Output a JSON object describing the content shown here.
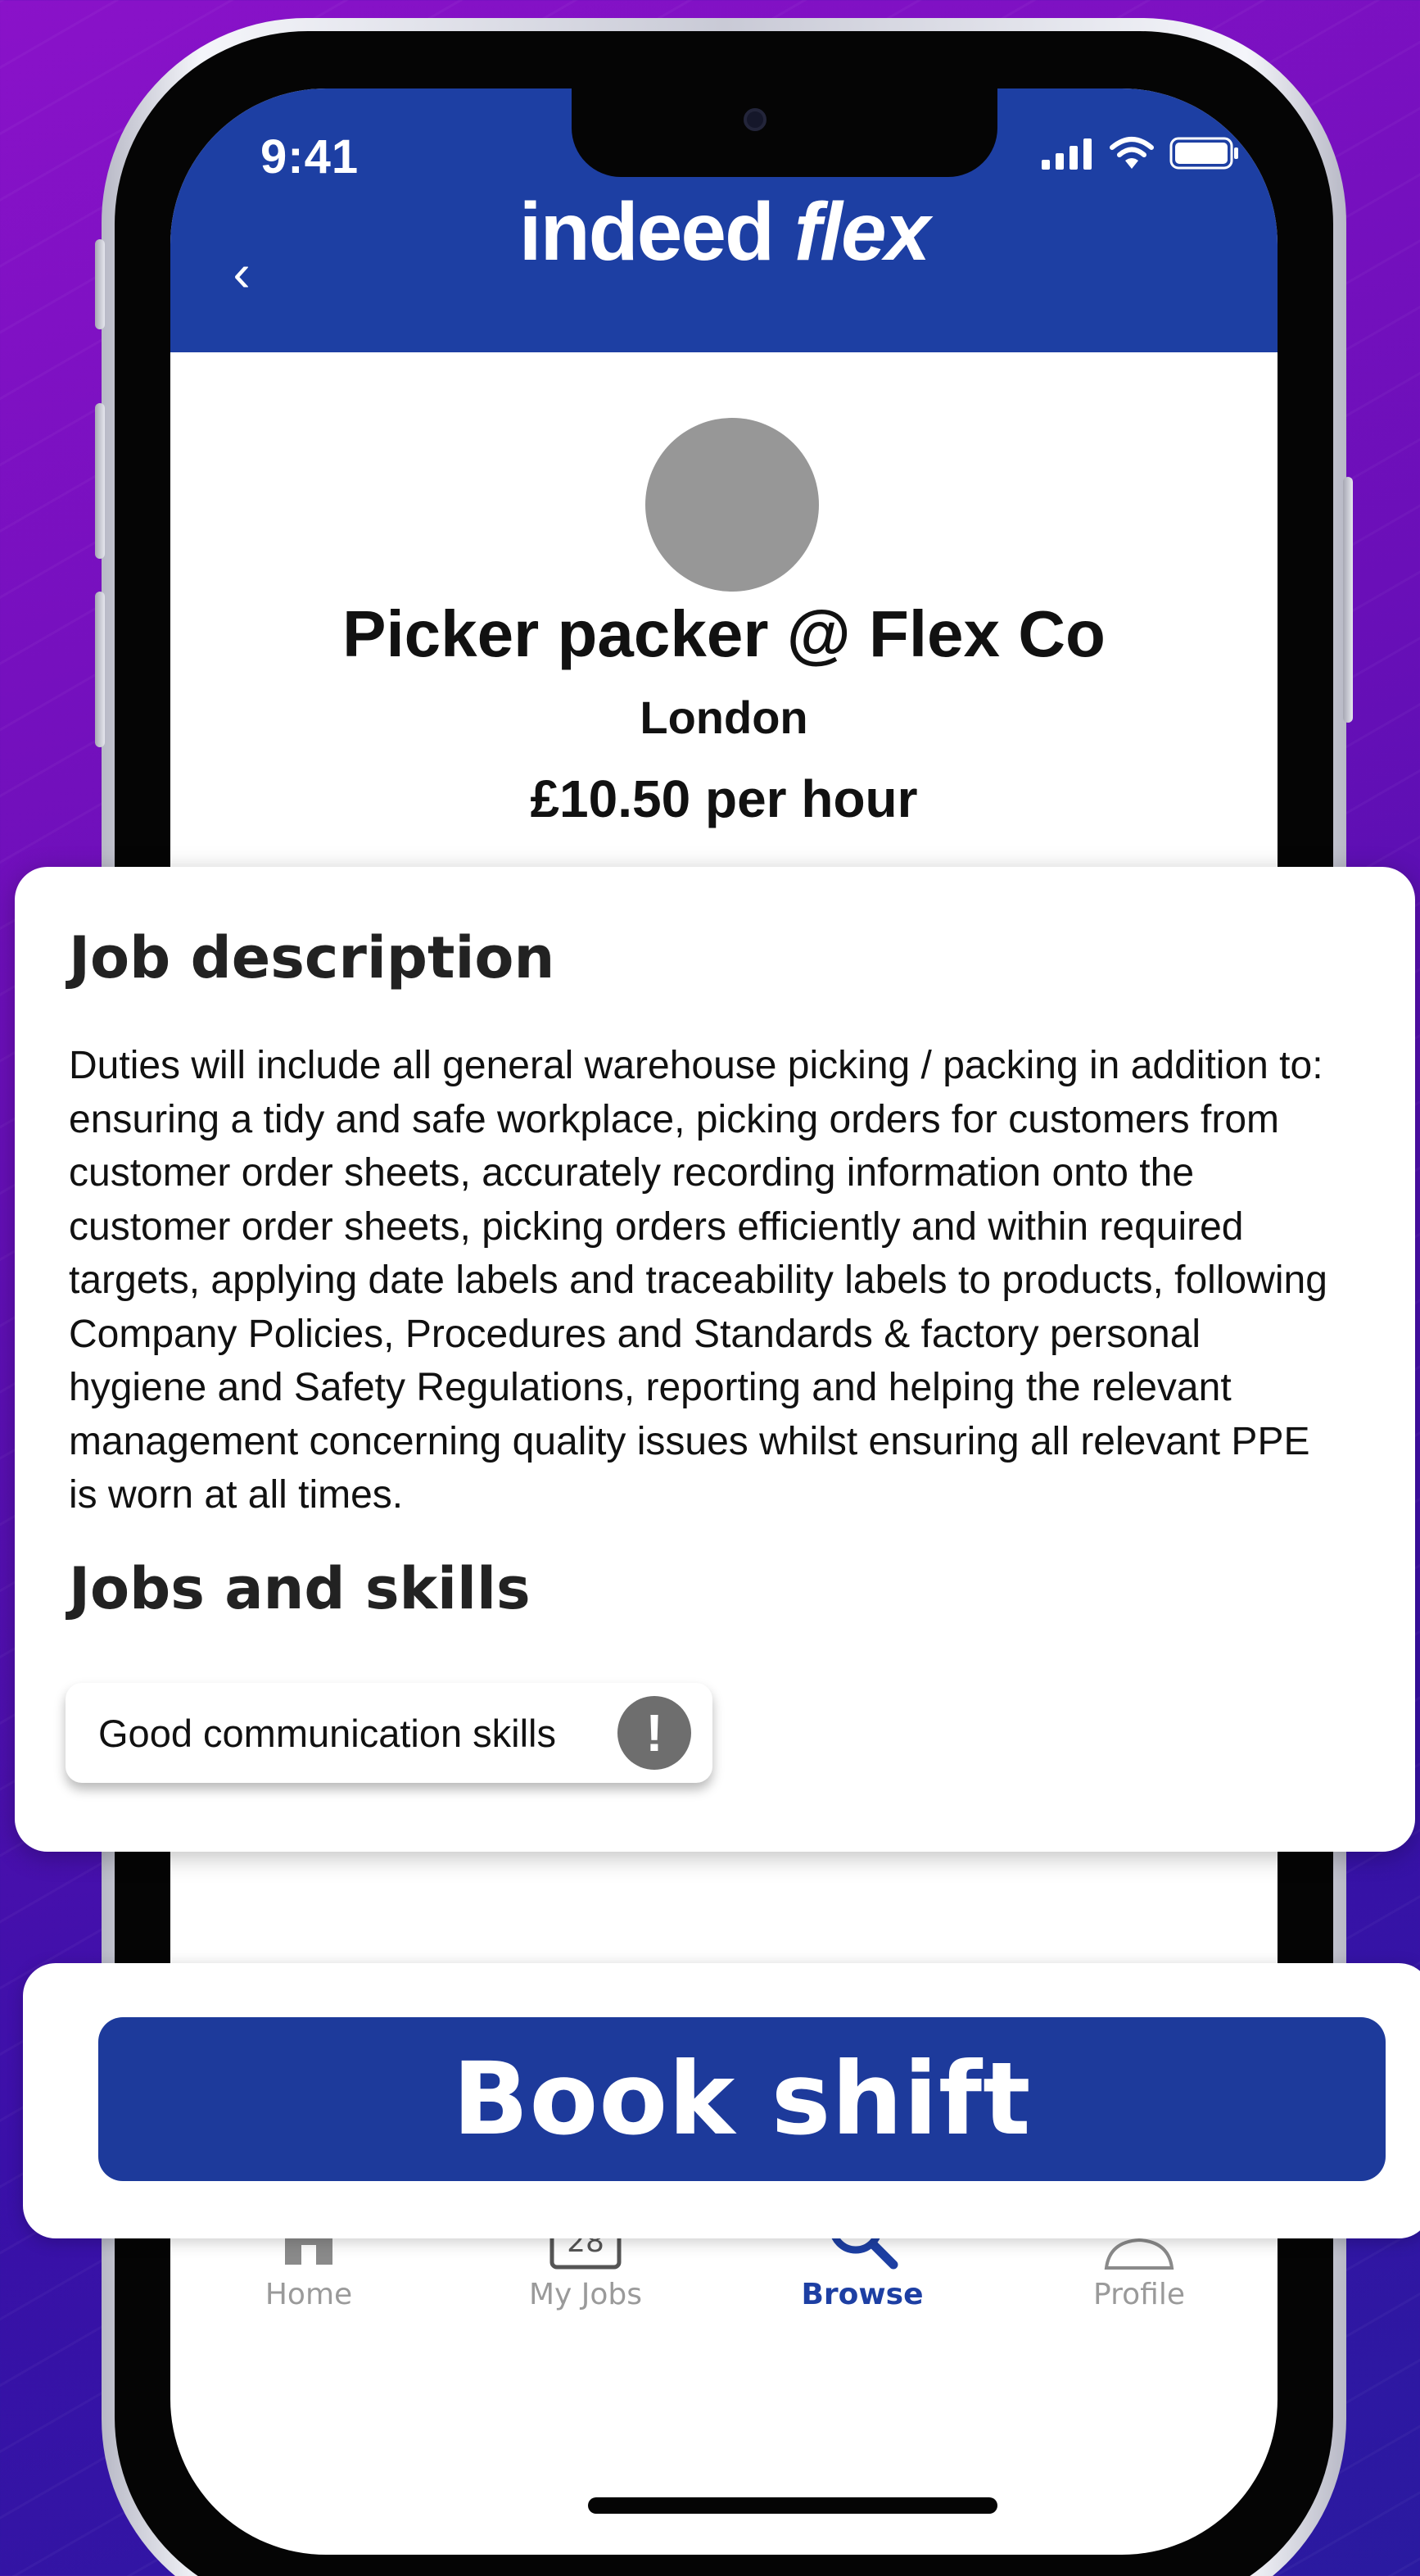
{
  "status_bar": {
    "time": "9:41"
  },
  "header": {
    "brand_main": "indeed",
    "brand_accent": "flex",
    "back_symbol": "‹"
  },
  "job": {
    "title": "Picker packer @ Flex Co",
    "location": "London",
    "rate": "£10.50 per hour"
  },
  "description": {
    "heading": "Job description",
    "text": "Duties will include all general warehouse picking / packing in addition to: ensuring a tidy and safe workplace, picking orders for customers from customer order sheets, accurately recording information onto the customer order sheets, picking orders efficiently and within required targets, applying date labels and traceability labels to products, following Company Policies, Procedures and Standards & factory personal hygiene and Safety Regulations, reporting and helping the relevant management concerning quality issues whilst ensuring all relevant PPE is worn at all times."
  },
  "skills": {
    "heading": "Jobs and skills",
    "items": [
      {
        "label": "Good communication skills",
        "icon": "alert-icon",
        "icon_symbol": "!"
      }
    ]
  },
  "book": {
    "label": "Book shift"
  },
  "nav": {
    "items": [
      {
        "label": "Home",
        "icon": "home-icon"
      },
      {
        "label": "My Jobs",
        "icon": "calendar-icon",
        "calendar_day": "28"
      },
      {
        "label": "Browse",
        "icon": "search-icon",
        "active": true
      },
      {
        "label": "Profile",
        "icon": "profile-icon"
      }
    ]
  },
  "colors": {
    "brand_blue": "#1d3fa3",
    "button_blue": "#1d3a9b",
    "background_purple": "#7a10c0",
    "avatar_gray": "#979797",
    "inactive_nav": "#9a9a9a"
  }
}
